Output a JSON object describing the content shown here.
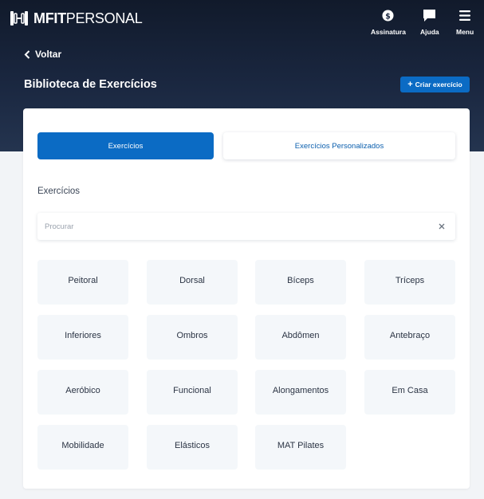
{
  "brand": {
    "bold": "MFIT",
    "light": "PERSONAL"
  },
  "nav": [
    {
      "label": "Assinatura",
      "icon": "dollar-icon"
    },
    {
      "label": "Ajuda",
      "icon": "chat-icon"
    },
    {
      "label": "Menu",
      "icon": "hamburger-icon"
    }
  ],
  "back_label": "Voltar",
  "page_title": "Biblioteca de Exercícios",
  "create_button": "Criar exercício",
  "tabs": [
    {
      "label": "Exercícios",
      "active": true
    },
    {
      "label": "Exercícios Personalizados",
      "active": false
    }
  ],
  "section_title": "Exercícios",
  "search": {
    "placeholder": "Procurar",
    "value": ""
  },
  "categories": [
    "Peitoral",
    "Dorsal",
    "Bíceps",
    "Tríceps",
    "Inferiores",
    "Ombros",
    "Abdômen",
    "Antebraço",
    "Aeróbico",
    "Funcional",
    "Alongamentos",
    "Em Casa",
    "Mobilidade",
    "Elásticos",
    "MAT Pilates"
  ],
  "colors": {
    "primary": "#0b6bc4",
    "header": "#1a2740",
    "tile": "#f4f7fa"
  }
}
